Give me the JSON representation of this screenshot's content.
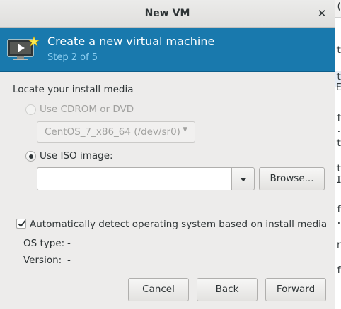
{
  "dialog": {
    "title": "New VM"
  },
  "banner": {
    "heading": "Create a new virtual machine",
    "step": "Step 2 of 5",
    "color": "#1979ad"
  },
  "install_media": {
    "section_label": "Locate your install media",
    "cdrom": {
      "label": "Use CDROM or DVD",
      "selected": false,
      "enabled": false,
      "device_value": "CentOS_7_x86_64 (/dev/sr0)"
    },
    "iso": {
      "label": "Use ISO image:",
      "selected": true,
      "path_value": "",
      "browse_label": "Browse..."
    }
  },
  "os_detect": {
    "checkbox_label": "Automatically detect operating system based on install media",
    "checked": true,
    "os_type_label": "OS type:",
    "os_type_value": "-",
    "version_label": "Version:",
    "version_value": "-"
  },
  "buttons": {
    "cancel": "Cancel",
    "back": "Back",
    "forward": "Forward"
  },
  "background_window": {
    "visible_chars": [
      "t",
      "t",
      "E",
      "f",
      ".",
      "t",
      "t",
      "I",
      "f",
      ".",
      "r",
      "f"
    ]
  }
}
